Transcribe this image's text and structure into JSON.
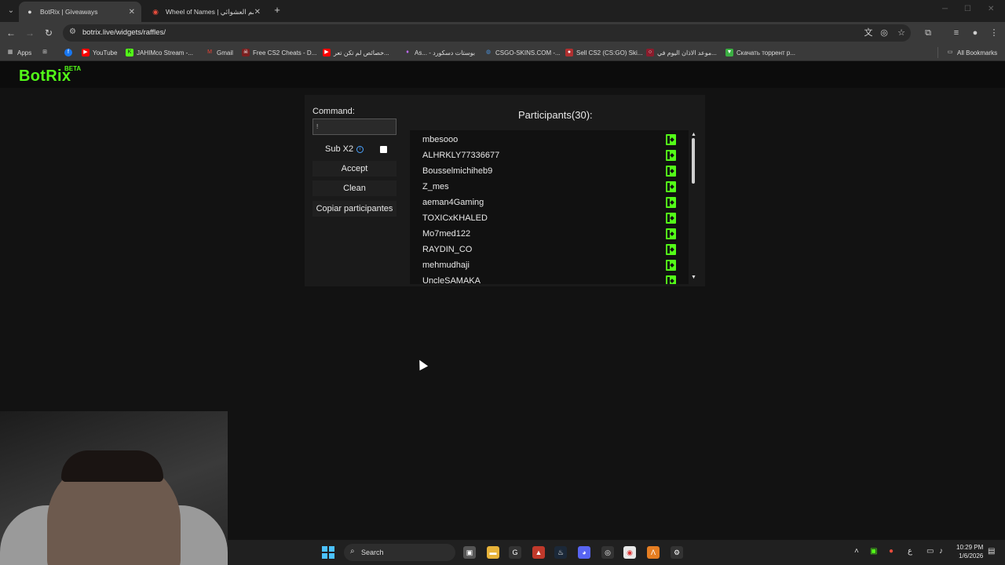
{
  "browser": {
    "tabs": [
      {
        "title": "BotRix | Giveaways",
        "active": true
      },
      {
        "title": "Wheel of Names | قسم العشوائي",
        "active": false
      }
    ],
    "url": "botrix.live/widgets/raffles/",
    "bookmarks": [
      {
        "label": "Apps",
        "icon": "grid-icon",
        "color": "#cccccc"
      },
      {
        "label": "",
        "icon": "facebook-icon",
        "color": "#1877f2"
      },
      {
        "label": "YouTube",
        "icon": "youtube-icon",
        "color": "#ff0000"
      },
      {
        "label": "JAHIMco Stream -...",
        "icon": "kick-icon",
        "color": "#53fc18"
      },
      {
        "label": "Gmail",
        "icon": "gmail-icon",
        "color": "#ea4335"
      },
      {
        "label": "Free CS2 Cheats - D...",
        "icon": "cheats-icon",
        "color": "#7a1f1f"
      },
      {
        "label": "خصائص لم تكن تعر...",
        "icon": "youtube-icon",
        "color": "#ff0000"
      },
      {
        "label": "As... - بوستات دسكورد",
        "icon": "gem-icon",
        "color": "#c36bff"
      },
      {
        "label": "CSGO-SKINS.COM -...",
        "icon": "globe-icon",
        "color": "#4a90d9"
      },
      {
        "label": "Sell CS2 (CS:GO) Ski...",
        "icon": "skins-icon",
        "color": "#b03030"
      },
      {
        "label": "موعد الاذان اليوم في...",
        "icon": "mosque-icon",
        "color": "#8a1c2c"
      },
      {
        "label": "Скачать торрент р...",
        "icon": "torrent-icon",
        "color": "#3cb043"
      }
    ],
    "all_bookmarks": "All Bookmarks"
  },
  "site": {
    "logo": "BotRix",
    "logo_badge": "BETA"
  },
  "raffle": {
    "command_label": "Command:",
    "command_value": "!",
    "sub_x2_label": "Sub X2",
    "accept_label": "Accept",
    "clean_label": "Clean",
    "copy_label": "Copiar participantes",
    "participants_title": "Participants(30):",
    "participants": [
      "mbesooo",
      "ALHRKLY77336677",
      "Bousselmichiheb9",
      "Z_mes",
      "aeman4Gaming",
      "TOXICxKHALED",
      "Mo7med122",
      "RAYDIN_CO",
      "mehmudhaji",
      "UncleSAMAKA"
    ]
  },
  "taskbar": {
    "search_label": "Search",
    "time": "10:29 PM",
    "date": "1/6/2026",
    "lang": "ع"
  },
  "colors": {
    "brand": "#53fc18",
    "info": "#4aa3ff"
  }
}
